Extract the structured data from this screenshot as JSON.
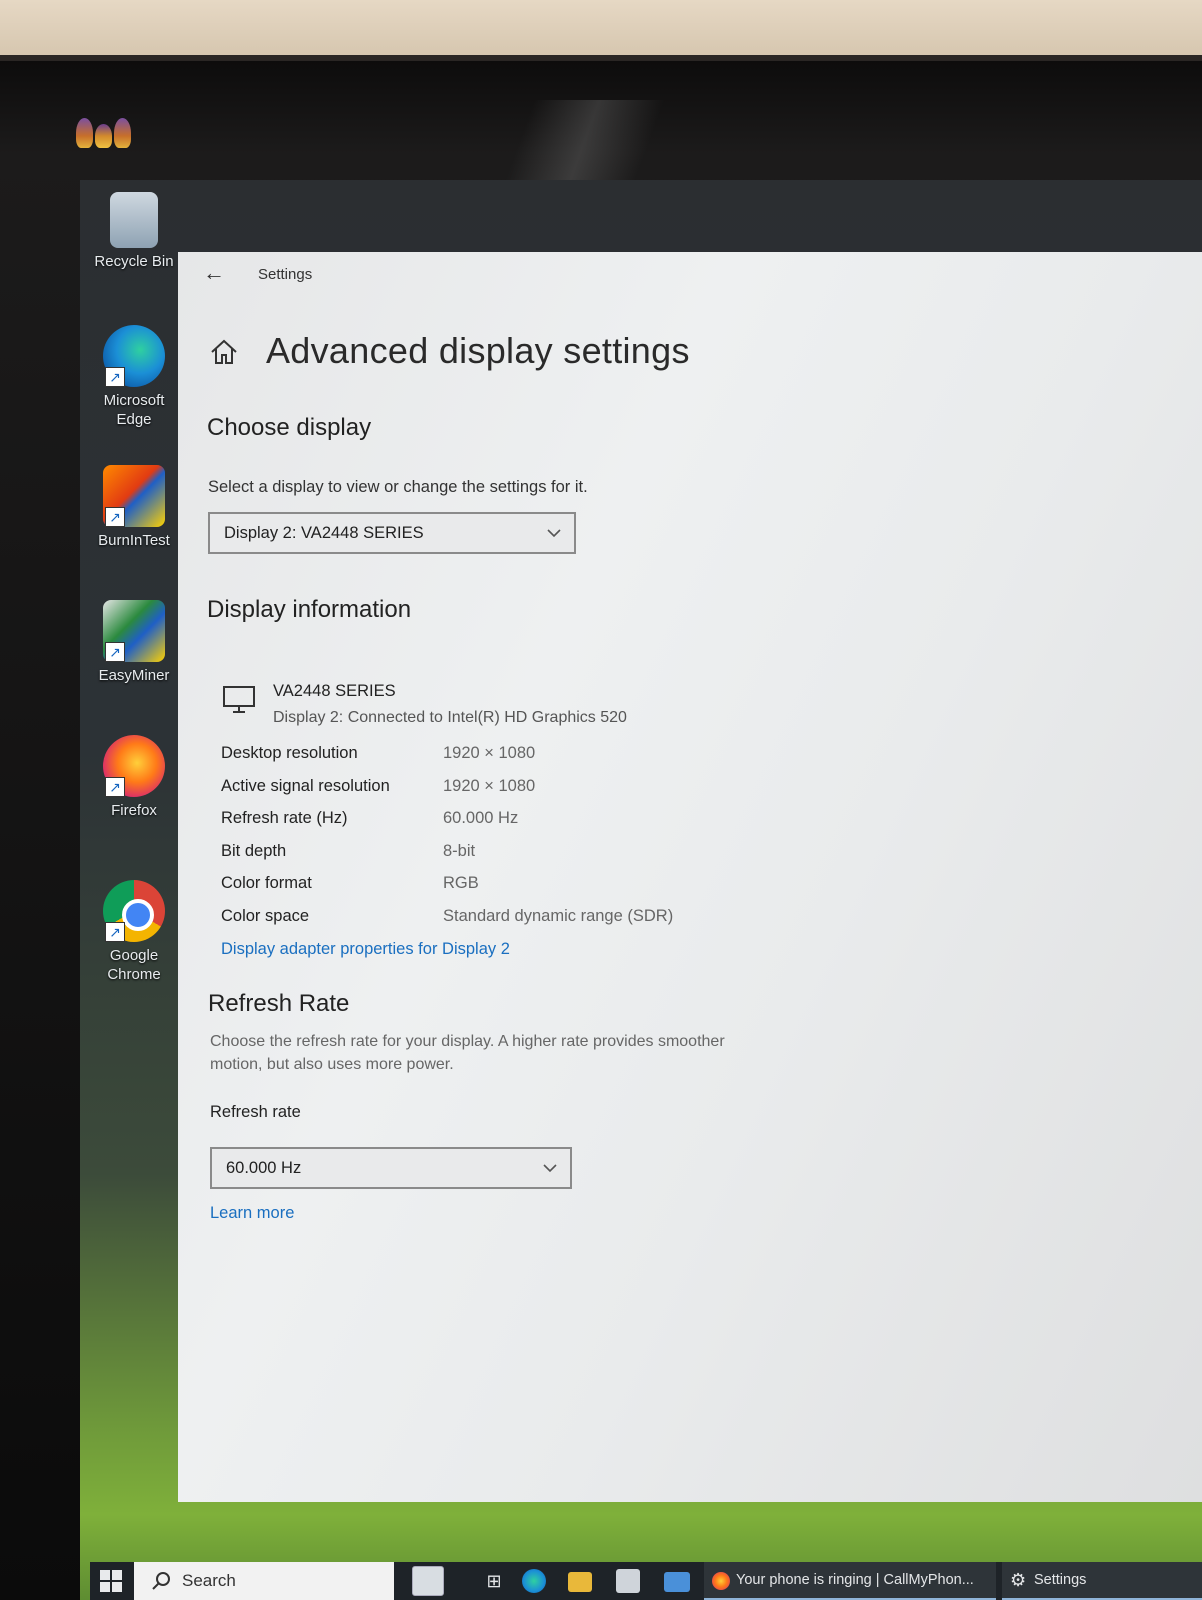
{
  "desktop": {
    "icons": [
      {
        "label": "Recycle Bin",
        "icon": "recycle-bin-icon"
      },
      {
        "label": "Microsoft Edge",
        "icon": "edge-icon"
      },
      {
        "label": "BurnInTest",
        "icon": "burnintest-icon"
      },
      {
        "label": "EasyMiner",
        "icon": "easyminer-icon"
      },
      {
        "label": "Firefox",
        "icon": "firefox-icon"
      },
      {
        "label": "Google Chrome",
        "icon": "chrome-icon"
      }
    ]
  },
  "window": {
    "title": "Settings",
    "back_icon": "back-arrow-icon"
  },
  "page": {
    "title": "Advanced display settings",
    "home_icon": "home-icon"
  },
  "choose_display": {
    "heading": "Choose display",
    "description": "Select a display to view or change the settings for it.",
    "selected": "Display 2: VA2448 SERIES"
  },
  "display_information": {
    "heading": "Display information",
    "monitor_name": "VA2448 SERIES",
    "connection": "Display 2: Connected to Intel(R) HD Graphics 520",
    "rows": [
      {
        "key": "Desktop resolution",
        "value": "1920 × 1080"
      },
      {
        "key": "Active signal resolution",
        "value": "1920 × 1080"
      },
      {
        "key": "Refresh rate (Hz)",
        "value": "60.000 Hz"
      },
      {
        "key": "Bit depth",
        "value": "8-bit"
      },
      {
        "key": "Color format",
        "value": "RGB"
      },
      {
        "key": "Color space",
        "value": "Standard dynamic range (SDR)"
      }
    ],
    "adapter_link": "Display adapter properties for Display 2"
  },
  "refresh_rate": {
    "heading": "Refresh Rate",
    "description": "Choose the refresh rate for your display. A higher rate provides smoother motion, but also uses more power.",
    "label": "Refresh rate",
    "selected": "60.000 Hz",
    "learn_more": "Learn more"
  },
  "taskbar": {
    "search_placeholder": "Search",
    "tasks": [
      {
        "label": "Your phone is ringing | CallMyPhon..."
      },
      {
        "label": "Settings"
      }
    ]
  },
  "colors": {
    "link": "#1a6fc0",
    "taskbar": "#1e2328",
    "window_bg": "#eceeef"
  }
}
